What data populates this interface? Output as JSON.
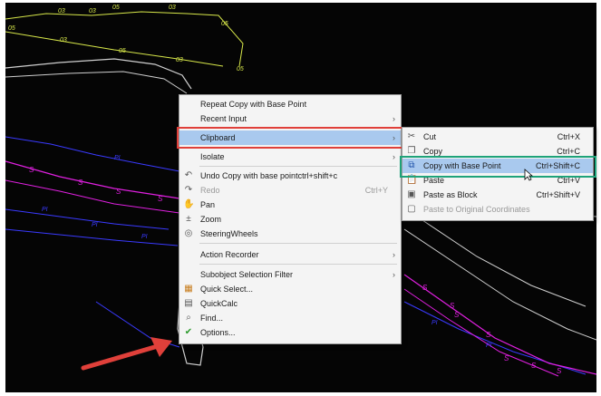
{
  "canvas": {
    "labels": {
      "yellow": [
        "03",
        "03",
        "05",
        "03",
        "05",
        "03",
        "05",
        "03",
        "05",
        "05"
      ],
      "blue": [
        "PI",
        "PI",
        "PI",
        "PI",
        "PI",
        "PI"
      ],
      "magenta": [
        "S",
        "S",
        "S",
        "S",
        "S",
        "S",
        "S",
        "S",
        "S",
        "S",
        "S"
      ]
    }
  },
  "context_menu": {
    "items": [
      {
        "label": "Repeat Copy with Base Point",
        "shortcut": "",
        "submenu": false,
        "icon": "",
        "disabled": false
      },
      {
        "label": "Recent Input",
        "shortcut": "",
        "submenu": true,
        "icon": "",
        "disabled": false
      },
      {
        "label": "Clipboard",
        "shortcut": "",
        "submenu": true,
        "icon": "",
        "disabled": false,
        "highlighted": true
      },
      {
        "label": "Isolate",
        "shortcut": "",
        "submenu": true,
        "icon": "",
        "disabled": false
      },
      {
        "label": "Undo Copy with base pointctrl+shift+c",
        "shortcut": "",
        "submenu": false,
        "icon": "undo-icon",
        "disabled": false
      },
      {
        "label": "Redo",
        "shortcut": "Ctrl+Y",
        "submenu": false,
        "icon": "redo-icon",
        "disabled": true
      },
      {
        "label": "Pan",
        "shortcut": "",
        "submenu": false,
        "icon": "pan-hand-icon",
        "disabled": false
      },
      {
        "label": "Zoom",
        "shortcut": "",
        "submenu": false,
        "icon": "zoom-icon",
        "disabled": false
      },
      {
        "label": "SteeringWheels",
        "shortcut": "",
        "submenu": false,
        "icon": "steering-wheel-icon",
        "disabled": false
      },
      {
        "label": "Action Recorder",
        "shortcut": "",
        "submenu": true,
        "icon": "",
        "disabled": false
      },
      {
        "label": "Subobject Selection Filter",
        "shortcut": "",
        "submenu": true,
        "icon": "",
        "disabled": false
      },
      {
        "label": "Quick Select...",
        "shortcut": "",
        "submenu": false,
        "icon": "quick-select-icon",
        "disabled": false
      },
      {
        "label": "QuickCalc",
        "shortcut": "",
        "submenu": false,
        "icon": "calculator-icon",
        "disabled": false
      },
      {
        "label": "Find...",
        "shortcut": "",
        "submenu": false,
        "icon": "find-icon",
        "disabled": false
      },
      {
        "label": "Options...",
        "shortcut": "",
        "submenu": false,
        "icon": "options-check-icon",
        "disabled": false
      }
    ]
  },
  "clipboard_submenu": {
    "items": [
      {
        "label": "Cut",
        "shortcut": "Ctrl+X",
        "icon": "cut-icon",
        "disabled": false
      },
      {
        "label": "Copy",
        "shortcut": "Ctrl+C",
        "icon": "copy-icon",
        "disabled": false
      },
      {
        "label": "Copy with Base Point",
        "shortcut": "Ctrl+Shift+C",
        "icon": "copy-base-point-icon",
        "disabled": false,
        "highlighted": true
      },
      {
        "label": "Paste",
        "shortcut": "Ctrl+V",
        "icon": "paste-icon",
        "disabled": false
      },
      {
        "label": "Paste as Block",
        "shortcut": "Ctrl+Shift+V",
        "icon": "paste-block-icon",
        "disabled": false
      },
      {
        "label": "Paste to Original Coordinates",
        "shortcut": "",
        "icon": "paste-original-icon",
        "disabled": true
      }
    ]
  },
  "colors": {
    "background": "#050505",
    "highlight": "#a9c9ee",
    "annotation_red": "#e0403a",
    "annotation_green": "#1ea37a",
    "arrow": "#e0403a",
    "yellow_line": "#d8e84a",
    "blue_line": "#3a3aff",
    "magenta_line": "#e020e0"
  }
}
